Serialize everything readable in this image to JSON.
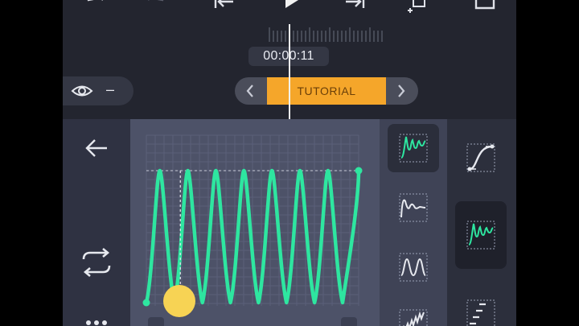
{
  "timeline": {
    "timecode": "00:00:11",
    "clip_label": "TUTORIAL",
    "opacity_dash": "–"
  },
  "icons": {
    "toolbar": [
      "undo-icon",
      "redo-icon",
      "back-to-start-icon",
      "play-icon",
      "forward-to-end-icon",
      "add-keyframe-icon",
      "fullscreen-icon"
    ],
    "left": [
      "arrow-left-icon",
      "loop-icon",
      "more-icon"
    ],
    "presets": [
      "bounce-curve-icon",
      "damped-wave-icon",
      "sine-wave-icon",
      "noise-curve-icon"
    ],
    "easings": [
      "ease-in-out-icon",
      "bounce-curve-icon",
      "steps-icon"
    ]
  },
  "graph": {
    "cycles": 7,
    "preview_progress": 0.16
  },
  "colors": {
    "accent_green": "#2ee6a0",
    "clip_orange": "#f5a62a",
    "preview_ball": "#f7d354",
    "panel_bg": "#3b3f52",
    "graph_bg": "#4d5268"
  }
}
